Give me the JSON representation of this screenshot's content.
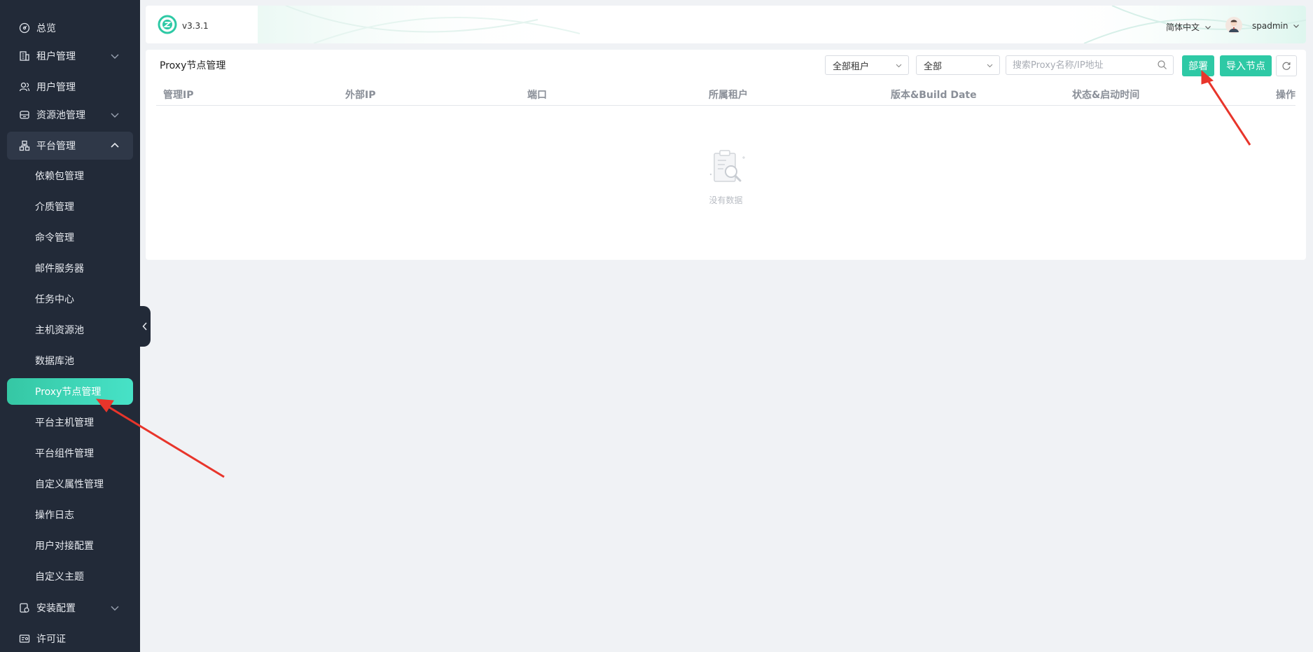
{
  "sidebar": {
    "items": [
      {
        "label": "总览",
        "icon": "dashboard-icon"
      },
      {
        "label": "租户管理",
        "icon": "building-icon"
      },
      {
        "label": "用户管理",
        "icon": "users-icon"
      },
      {
        "label": "资源池管理",
        "icon": "database-icon"
      },
      {
        "label": "平台管理",
        "icon": "network-icon"
      },
      {
        "label": "安装配置",
        "icon": "install-icon"
      },
      {
        "label": "许可证",
        "icon": "license-icon"
      }
    ],
    "sub_items": [
      {
        "label": "依赖包管理"
      },
      {
        "label": "介质管理"
      },
      {
        "label": "命令管理"
      },
      {
        "label": "邮件服务器"
      },
      {
        "label": "任务中心"
      },
      {
        "label": "主机资源池"
      },
      {
        "label": "数据库池"
      },
      {
        "label": "Proxy节点管理"
      },
      {
        "label": "平台主机管理"
      },
      {
        "label": "平台组件管理"
      },
      {
        "label": "自定义属性管理"
      },
      {
        "label": "操作日志"
      },
      {
        "label": "用户对接配置"
      },
      {
        "label": "自定义主题"
      }
    ]
  },
  "header": {
    "version": "v3.3.1",
    "language": "简体中文",
    "username": "spadmin"
  },
  "main": {
    "title": "Proxy节点管理",
    "tenant_select": "全部租户",
    "status_select": "全部",
    "search_placeholder": "搜索Proxy名称/IP地址",
    "deploy_button": "部署",
    "import_button": "导入节点",
    "columns": [
      "管理IP",
      "外部IP",
      "端口",
      "所属租户",
      "版本&Build Date",
      "状态&启动时间",
      "操作"
    ],
    "empty_text": "没有数据"
  },
  "colors": {
    "sidebar_bg": "#222a38",
    "accent": "#2ec9a5",
    "annotation_arrow": "#e8352b"
  }
}
